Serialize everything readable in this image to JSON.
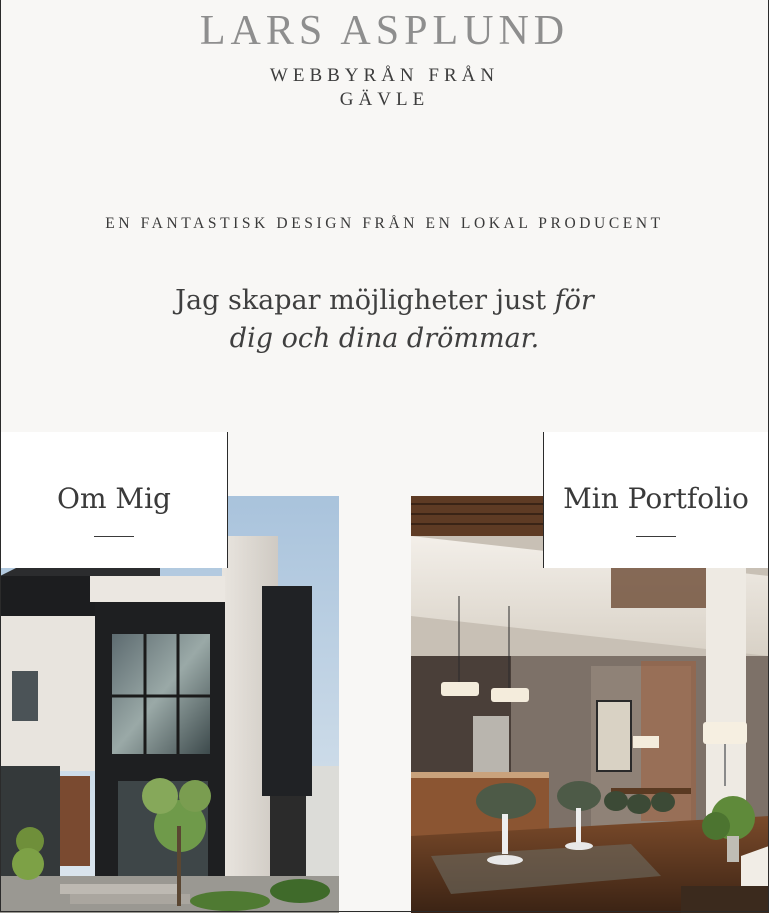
{
  "brand": {
    "name": "LARS ASPLUND",
    "tagline": "WEBBYRÅN FRÅN GÄVLE"
  },
  "intro": {
    "eyebrow": "EN FANTASTISK DESIGN FRÅN EN LOKAL PRODUCENT",
    "hero_line1_plain": "Jag skapar möjligheter just ",
    "hero_line1_italic": "för",
    "hero_line2_italic": "dig och dina drömmar."
  },
  "cards": [
    {
      "label": "Om Mig",
      "image": "modern-house-exterior-photo"
    },
    {
      "label": "Min Portfolio",
      "image": "modern-interior-living-room-photo"
    }
  ],
  "colors": {
    "background": "#f8f7f5",
    "brand_name": "#8e8e8e",
    "text": "#3a3a3a",
    "card_label_bg": "#ffffff"
  }
}
